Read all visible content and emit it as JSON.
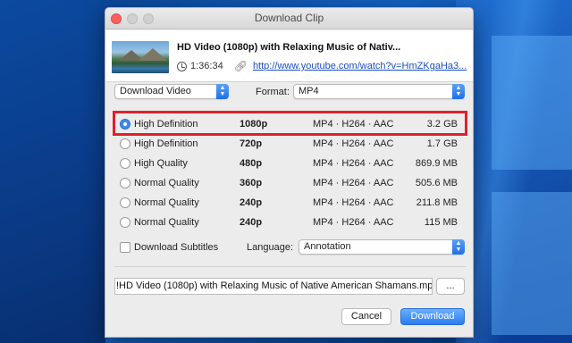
{
  "window": {
    "title": "Download Clip"
  },
  "clip": {
    "title": "HD Video (1080p) with Relaxing Music of Nativ...",
    "duration": "1:36:34",
    "url": "http://www.youtube.com/watch?v=HmZKgaHa3..."
  },
  "options": {
    "action_selected": "Download Video",
    "format_label": "Format:",
    "format_selected": "MP4"
  },
  "qualities": [
    {
      "label": "High Definition",
      "resolution": "1080p",
      "format": "MP4 · H264 · AAC",
      "size": "3.2 GB",
      "selected": true
    },
    {
      "label": "High Definition",
      "resolution": "720p",
      "format": "MP4 · H264 · AAC",
      "size": "1.7 GB",
      "selected": false
    },
    {
      "label": "High Quality",
      "resolution": "480p",
      "format": "MP4 · H264 · AAC",
      "size": "869.9 MB",
      "selected": false
    },
    {
      "label": "Normal Quality",
      "resolution": "360p",
      "format": "MP4 · H264 · AAC",
      "size": "505.6 MB",
      "selected": false
    },
    {
      "label": "Normal Quality",
      "resolution": "240p",
      "format": "MP4 · H264 · AAC",
      "size": "211.8 MB",
      "selected": false
    },
    {
      "label": "Normal Quality",
      "resolution": "240p",
      "format": "MP4 · H264 · AAC",
      "size": "115 MB",
      "selected": false
    }
  ],
  "subtitles": {
    "checkbox_label": "Download Subtitles",
    "checked": false,
    "language_label": "Language:",
    "language_selected": "Annotation"
  },
  "output": {
    "filename": "!HD Video (1080p) with Relaxing Music of Native American Shamans.mp4",
    "browse_label": "..."
  },
  "buttons": {
    "cancel": "Cancel",
    "download": "Download"
  },
  "colors": {
    "highlight": "#e0202a",
    "accent": "#2a7cf0"
  }
}
